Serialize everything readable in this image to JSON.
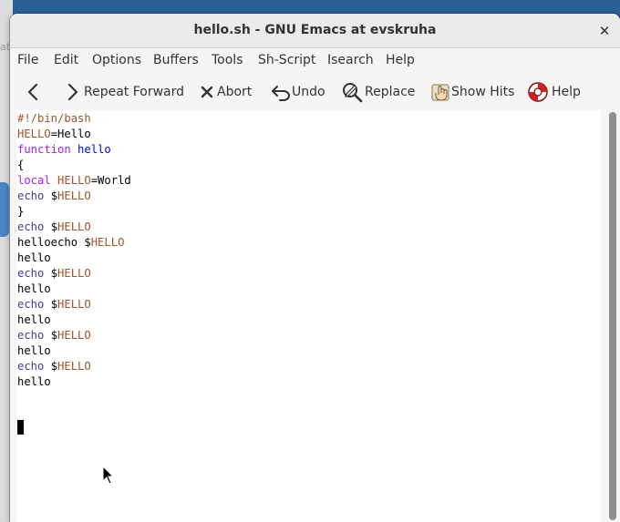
{
  "window": {
    "title": "hello.sh - GNU Emacs at evskruha",
    "close_glyph": "✕"
  },
  "background": {
    "partial_text": "ab"
  },
  "menubar": {
    "items": [
      "File",
      "Edit",
      "Options",
      "Buffers",
      "Tools",
      "Sh-Script",
      "Isearch",
      "Help"
    ]
  },
  "toolbar": {
    "back_icon": "chevron-left-icon",
    "repeat_forward": "Repeat Forward",
    "abort": "Abort",
    "undo": "Undo",
    "replace": "Replace",
    "show_hits": "Show Hits",
    "help": "Help"
  },
  "editor": {
    "lines": [
      [
        {
          "t": "#!/bin/bash",
          "c": "c-comment"
        }
      ],
      [
        {
          "t": "HELLO",
          "c": "c-var"
        },
        {
          "t": "=Hello",
          "c": ""
        }
      ],
      [
        {
          "t": "function",
          "c": "c-kw"
        },
        {
          "t": " ",
          "c": ""
        },
        {
          "t": "hello",
          "c": "c-fn"
        }
      ],
      [
        {
          "t": "{",
          "c": ""
        }
      ],
      [
        {
          "t": "local",
          "c": "c-kw"
        },
        {
          "t": " ",
          "c": ""
        },
        {
          "t": "HELLO",
          "c": "c-var"
        },
        {
          "t": "=World",
          "c": ""
        }
      ],
      [
        {
          "t": "echo",
          "c": "c-builtin"
        },
        {
          "t": " $",
          "c": ""
        },
        {
          "t": "HELLO",
          "c": "c-var"
        }
      ],
      [
        {
          "t": "}",
          "c": ""
        }
      ],
      [
        {
          "t": "echo",
          "c": "c-builtin"
        },
        {
          "t": " $",
          "c": ""
        },
        {
          "t": "HELLO",
          "c": "c-var"
        }
      ],
      [
        {
          "t": "helloecho $",
          "c": ""
        },
        {
          "t": "HELLO",
          "c": "c-var"
        }
      ],
      [
        {
          "t": "hello",
          "c": ""
        }
      ],
      [
        {
          "t": "echo",
          "c": "c-builtin"
        },
        {
          "t": " $",
          "c": ""
        },
        {
          "t": "HELLO",
          "c": "c-var"
        }
      ],
      [
        {
          "t": "hello",
          "c": ""
        }
      ],
      [
        {
          "t": "echo",
          "c": "c-builtin"
        },
        {
          "t": " $",
          "c": ""
        },
        {
          "t": "HELLO",
          "c": "c-var"
        }
      ],
      [
        {
          "t": "hello",
          "c": ""
        }
      ],
      [
        {
          "t": "echo",
          "c": "c-builtin"
        },
        {
          "t": " $",
          "c": ""
        },
        {
          "t": "HELLO",
          "c": "c-var"
        }
      ],
      [
        {
          "t": "hello",
          "c": ""
        }
      ],
      [
        {
          "t": "echo",
          "c": "c-builtin"
        },
        {
          "t": " $",
          "c": ""
        },
        {
          "t": "HELLO",
          "c": "c-var"
        }
      ],
      [
        {
          "t": "hello",
          "c": ""
        }
      ]
    ]
  },
  "colors": {
    "comment": "#a0522d",
    "keyword": "#a020f0",
    "function_name": "#0000ff",
    "variable": "#a0522d",
    "builtin": "#483d8b"
  }
}
